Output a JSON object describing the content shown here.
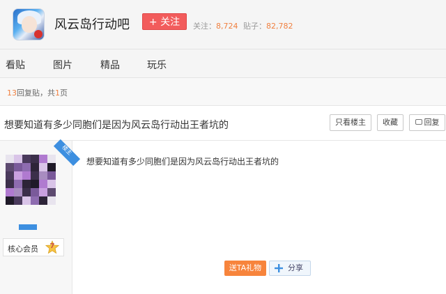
{
  "header": {
    "forum_name": "风云岛行动吧",
    "follow_label": "+ 关注",
    "follow_count_label": "关注：",
    "follow_count": "8,724",
    "post_count_label": "贴子：",
    "post_count": "82,782"
  },
  "nav": {
    "items": [
      {
        "label": "看贴"
      },
      {
        "label": "图片"
      },
      {
        "label": "精品"
      },
      {
        "label": "玩乐"
      }
    ]
  },
  "pager": {
    "reply_count": "13",
    "reply_suffix": "回复贴，共",
    "page_count": "1",
    "page_suffix": "页"
  },
  "thread": {
    "title": "想要知道有多少同胞们是因为风云岛行动出王者坑的",
    "only_author_label": "只看楼主",
    "favorite_label": "收藏",
    "reply_label": "回复"
  },
  "author": {
    "role_tag": "楼主",
    "member_title": "核心会员",
    "level": "7"
  },
  "post": {
    "content": "想要知道有多少同胞们是因为风云岛行动出王者坑的",
    "gift_label": "送TA礼物",
    "share_label": "分享"
  },
  "colors": {
    "accent_red": "#f25c5c",
    "number_orange": "#f08040",
    "brand_blue": "#3d8fe0",
    "gift_orange": "#f7843c"
  }
}
